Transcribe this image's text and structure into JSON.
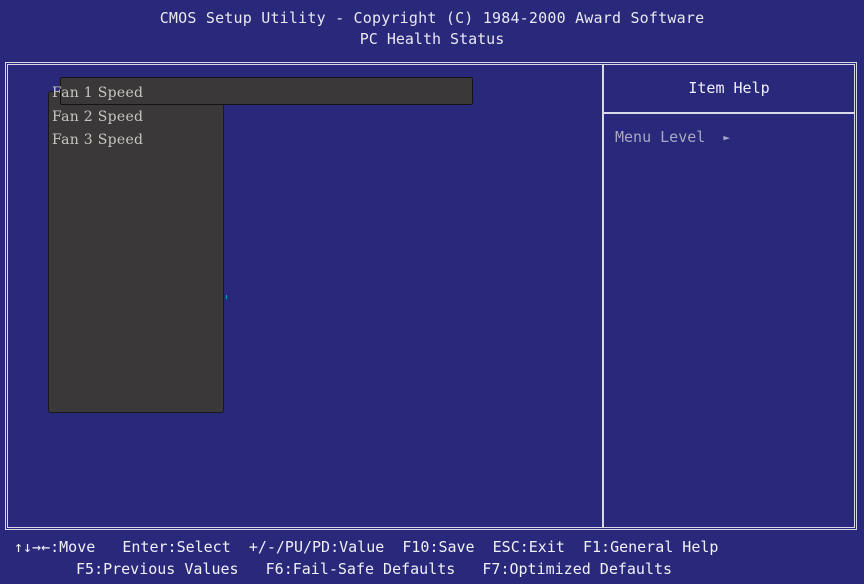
{
  "header": {
    "title": "CMOS Setup Utility - Copyright (C) 1984-2000 Award Software",
    "subtitle": "PC Health Status"
  },
  "menu": {
    "items": [
      {
        "label": "Fan 1 Speed"
      },
      {
        "label": "Fan 2 Speed"
      },
      {
        "label": "Fan 3 Speed"
      }
    ],
    "selected_index": 0
  },
  "help_panel": {
    "title": "Item Help",
    "menu_level_label": "Menu Level",
    "menu_level_arrow": "►"
  },
  "footer": {
    "row1": [
      {
        "key": "↑↓→←",
        "action": "Move"
      },
      {
        "key": "Enter",
        "action": "Select"
      },
      {
        "key": "+/-/PU/PD",
        "action": "Value"
      },
      {
        "key": "F10",
        "action": "Save"
      },
      {
        "key": "ESC",
        "action": "Exit"
      },
      {
        "key": "F1",
        "action": "General Help"
      }
    ],
    "row2": [
      {
        "key": "F5",
        "action": "Previous Values"
      },
      {
        "key": "F6",
        "action": "Fail-Safe Defaults"
      },
      {
        "key": "F7",
        "action": "Optimized Defaults"
      }
    ]
  },
  "colors": {
    "background": "#29287a",
    "popup": "#3a3838",
    "text": "#e8e8f0",
    "menu_text": "#c8c6c0",
    "help_text": "#a8a8c4"
  }
}
